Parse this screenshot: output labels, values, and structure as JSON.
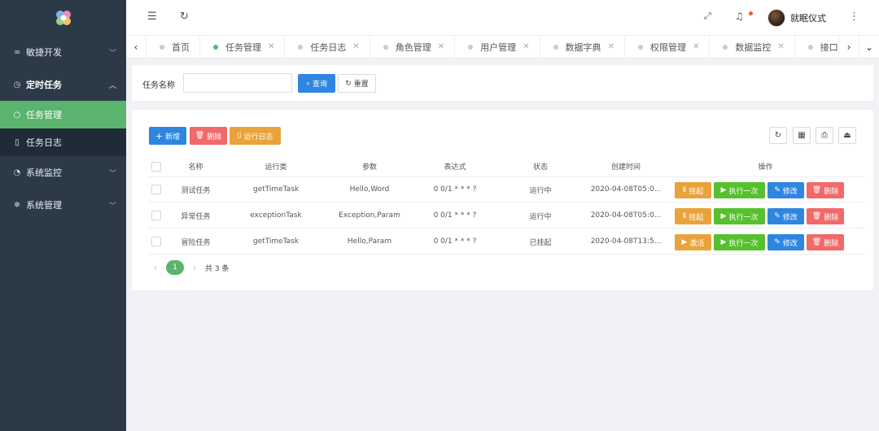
{
  "sidebar": {
    "menus": [
      {
        "label": "敏捷开发",
        "icon": "infinity-icon"
      },
      {
        "label": "定时任务",
        "icon": "clock-icon"
      },
      {
        "label": "系统监控",
        "icon": "gauge-icon"
      },
      {
        "label": "系统管理",
        "icon": "gear-icon"
      }
    ],
    "submenu": [
      {
        "label": "任务管理",
        "icon": "circle-icon"
      },
      {
        "label": "任务日志",
        "icon": "document-icon"
      }
    ]
  },
  "header": {
    "username": "就眠仪式"
  },
  "tabs": [
    {
      "label": "首页",
      "active": false,
      "closable": false
    },
    {
      "label": "任务管理",
      "active": true,
      "closable": true
    },
    {
      "label": "任务日志",
      "active": false,
      "closable": true
    },
    {
      "label": "角色管理",
      "active": false,
      "closable": true
    },
    {
      "label": "用户管理",
      "active": false,
      "closable": true
    },
    {
      "label": "数据字典",
      "active": false,
      "closable": true
    },
    {
      "label": "权限管理",
      "active": false,
      "closable": true
    },
    {
      "label": "数据监控",
      "active": false,
      "closable": true
    },
    {
      "label": "接口文档",
      "active": false,
      "closable": true
    }
  ],
  "search": {
    "label": "任务名称",
    "value": "",
    "query_button": "查询",
    "reset_button": "重置"
  },
  "toolbar": {
    "add": "新增",
    "delete": "删除",
    "log": "运行日志"
  },
  "table": {
    "columns": [
      "名称",
      "运行类",
      "参数",
      "表达式",
      "状态",
      "创建时间",
      "操作"
    ],
    "rows": [
      {
        "name": "测试任务",
        "class": "getTimeTask",
        "params": "Hello,Word",
        "expr": "0 0/1 * * * ?",
        "status": "运行中",
        "created": "2020-04-08T05:0...",
        "toggle": "挂起"
      },
      {
        "name": "异常任务",
        "class": "exceptionTask",
        "params": "Exception,Param",
        "expr": "0 0/1 * * * ?",
        "status": "运行中",
        "created": "2020-04-08T05:0...",
        "toggle": "挂起"
      },
      {
        "name": "冒险任务",
        "class": "getTimeTask",
        "params": "Hello,Param",
        "expr": "0 0/1 * * * ?",
        "status": "已挂起",
        "created": "2020-04-08T13:5...",
        "toggle": "激活"
      }
    ],
    "ops": {
      "run_once": "执行一次",
      "edit": "修改",
      "delete": "删除"
    }
  },
  "pager": {
    "current": "1",
    "total": "共 3 条"
  },
  "colors": {
    "sidebar_bg": "#2c3a47",
    "active_green": "#5ab46e",
    "primary_blue": "#2f86e0",
    "danger_red": "#f26969",
    "warning_orange": "#eaa33a",
    "success_green": "#56c02e"
  }
}
